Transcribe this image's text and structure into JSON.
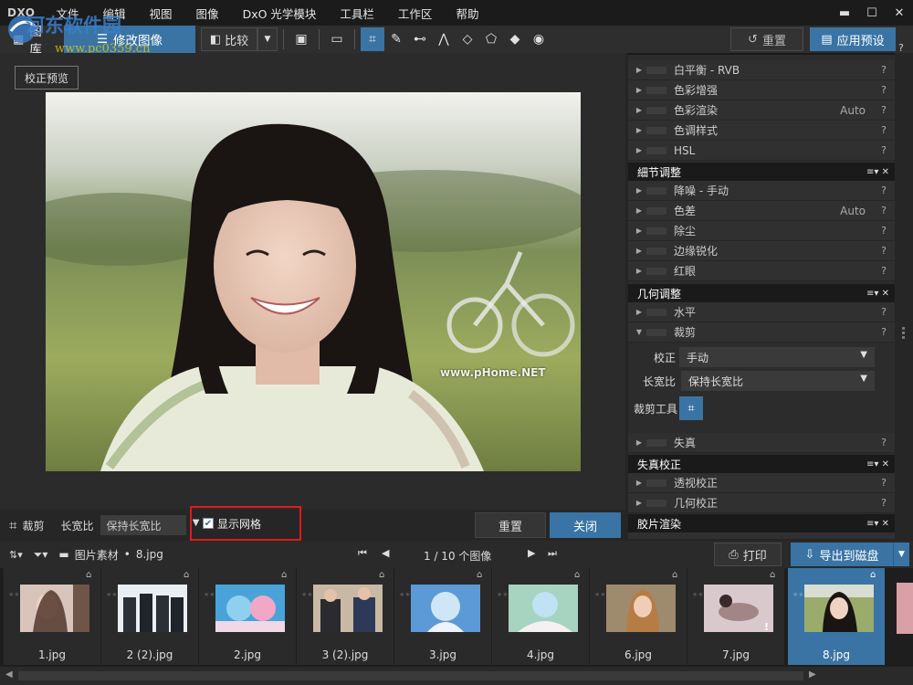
{
  "app": {
    "brand": "DXO",
    "menu": [
      "文件",
      "编辑",
      "视图",
      "图像",
      "DxO 光学模块",
      "工具栏",
      "工作区",
      "帮助"
    ],
    "window_controls": [
      "▬",
      "☐",
      "✕"
    ]
  },
  "watermark": {
    "text": "河东软件园",
    "url": "www.pc0359.cn",
    "photo_text": "www.pHome.NET"
  },
  "toolbar": {
    "library_label": "图库",
    "edit_label": "修改图像",
    "compare_label": "比较",
    "reset_label": "重置",
    "apply_preset_label": "应用预设",
    "icons": [
      "compare-view-icon",
      "fullscreen-icon",
      "crop-icon",
      "eyedropper-icon",
      "horizon-icon",
      "perspective-icon",
      "shape-icon",
      "polygon-icon",
      "eraser-icon",
      "eye-icon"
    ]
  },
  "viewer": {
    "preview_button": "校正预览"
  },
  "cropbar": {
    "crop_label": "裁剪",
    "ratio_label": "长宽比",
    "ratio_value": "保持长宽比",
    "show_grid_label": "显示网格",
    "show_grid_checked": true,
    "reset_label": "重置",
    "close_label": "关闭"
  },
  "panel": {
    "color_rows": [
      {
        "label": "白平衡 - RVB",
        "value": ""
      },
      {
        "label": "色彩增强",
        "value": ""
      },
      {
        "label": "色彩渲染",
        "value": "Auto"
      },
      {
        "label": "色调样式",
        "value": ""
      },
      {
        "label": "HSL",
        "value": ""
      }
    ],
    "detail_section": "細节调整",
    "detail_rows": [
      {
        "label": "降噪 - 手动",
        "value": ""
      },
      {
        "label": "色差",
        "value": "Auto"
      },
      {
        "label": "除尘",
        "value": ""
      },
      {
        "label": "边缘锐化",
        "value": ""
      },
      {
        "label": "红眼",
        "value": ""
      }
    ],
    "geometry_section": "几何调整",
    "geometry_rows": [
      {
        "label": "水平",
        "value": ""
      },
      {
        "label": "裁剪",
        "value": ""
      }
    ],
    "crop_sub": {
      "correction_label": "校正",
      "correction_value": "手动",
      "ratio_label": "长宽比",
      "ratio_value": "保持长宽比",
      "tool_label": "裁剪工具"
    },
    "distortion_row": {
      "label": "失真",
      "value": ""
    },
    "distortion_section": "失真校正",
    "distortion_rows": [
      {
        "label": "透视校正",
        "value": ""
      },
      {
        "label": "几何校正",
        "value": ""
      }
    ],
    "film_section": "胶片渲染",
    "help_mark": "?",
    "section_ctrl": "≡▾ ✕"
  },
  "filmbar": {
    "folder": "图片素材",
    "file": "8.jpg",
    "separator": "•",
    "nav_text": "1 / 10  个图像",
    "print_label": "打印",
    "export_label": "导出到磁盘"
  },
  "filmstrip": {
    "thumbs": [
      {
        "name": "1.jpg",
        "selected": false,
        "badge": false
      },
      {
        "name": "2 (2).jpg",
        "selected": false,
        "badge": false
      },
      {
        "name": "2.jpg",
        "selected": false,
        "badge": false
      },
      {
        "name": "3 (2).jpg",
        "selected": false,
        "badge": false
      },
      {
        "name": "3.jpg",
        "selected": false,
        "badge": false
      },
      {
        "name": "4.jpg",
        "selected": false,
        "badge": false
      },
      {
        "name": "6.jpg",
        "selected": false,
        "badge": false
      },
      {
        "name": "7.jpg",
        "selected": false,
        "badge": true
      },
      {
        "name": "8.jpg",
        "selected": true,
        "badge": false
      }
    ]
  },
  "colors": {
    "accent": "#3a74a4",
    "highlight_border": "#e01a1a"
  }
}
